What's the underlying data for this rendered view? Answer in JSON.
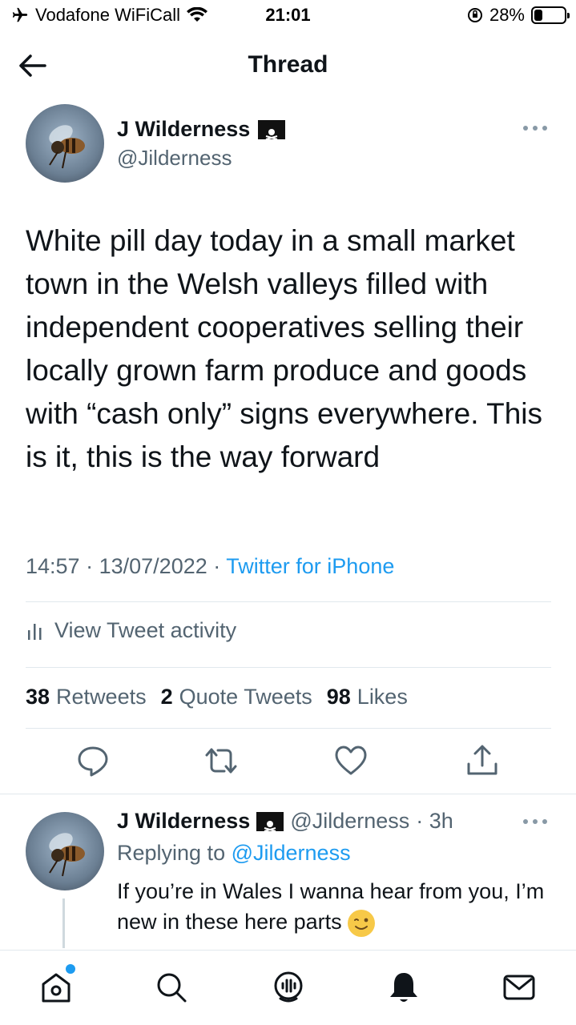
{
  "status_bar": {
    "carrier": "Vodafone WiFiCall",
    "time": "21:01",
    "battery_percent": "28%",
    "battery_level": 0.28,
    "icons": [
      "airplane-icon",
      "wifi-icon",
      "orientation-lock-icon",
      "battery-icon"
    ]
  },
  "header": {
    "title": "Thread",
    "back_icon": "arrow-left-icon"
  },
  "tweet": {
    "author_name": "J Wilderness",
    "author_badge_icon": "pirate-flag-icon",
    "handle": "@Jilderness",
    "text": "White pill day today in a small market town in the Welsh valleys filled with independent cooperatives selling their locally grown farm produce and goods with “cash only” signs everywhere. This is it, this is the way forward",
    "time": "14:57",
    "date": "13/07/2022",
    "separator": "·",
    "source": "Twitter for iPhone",
    "activity_label": "View Tweet activity",
    "stats": {
      "retweets_count": "38",
      "retweets_label": "Retweets",
      "quotes_count": "2",
      "quotes_label": "Quote Tweets",
      "likes_count": "98",
      "likes_label": "Likes"
    },
    "actions": [
      "reply-icon",
      "retweet-icon",
      "like-icon",
      "share-icon"
    ]
  },
  "reply": {
    "author_name": "J Wilderness",
    "handle": "@Jilderness",
    "age": "· 3h",
    "replying_prefix": "Replying to",
    "replying_to": "@Jilderness",
    "text": "If you’re in Wales I wanna hear from you, I’m new in these here parts",
    "emoji_icon": "winking-face-icon"
  },
  "tab_bar": {
    "tabs": [
      "home-icon",
      "search-icon",
      "spaces-icon",
      "notifications-icon",
      "messages-icon"
    ]
  },
  "colors": {
    "accent": "#1d9bf0",
    "text": "#0f1419",
    "secondary": "#536471",
    "divider": "#e1e8ed"
  }
}
